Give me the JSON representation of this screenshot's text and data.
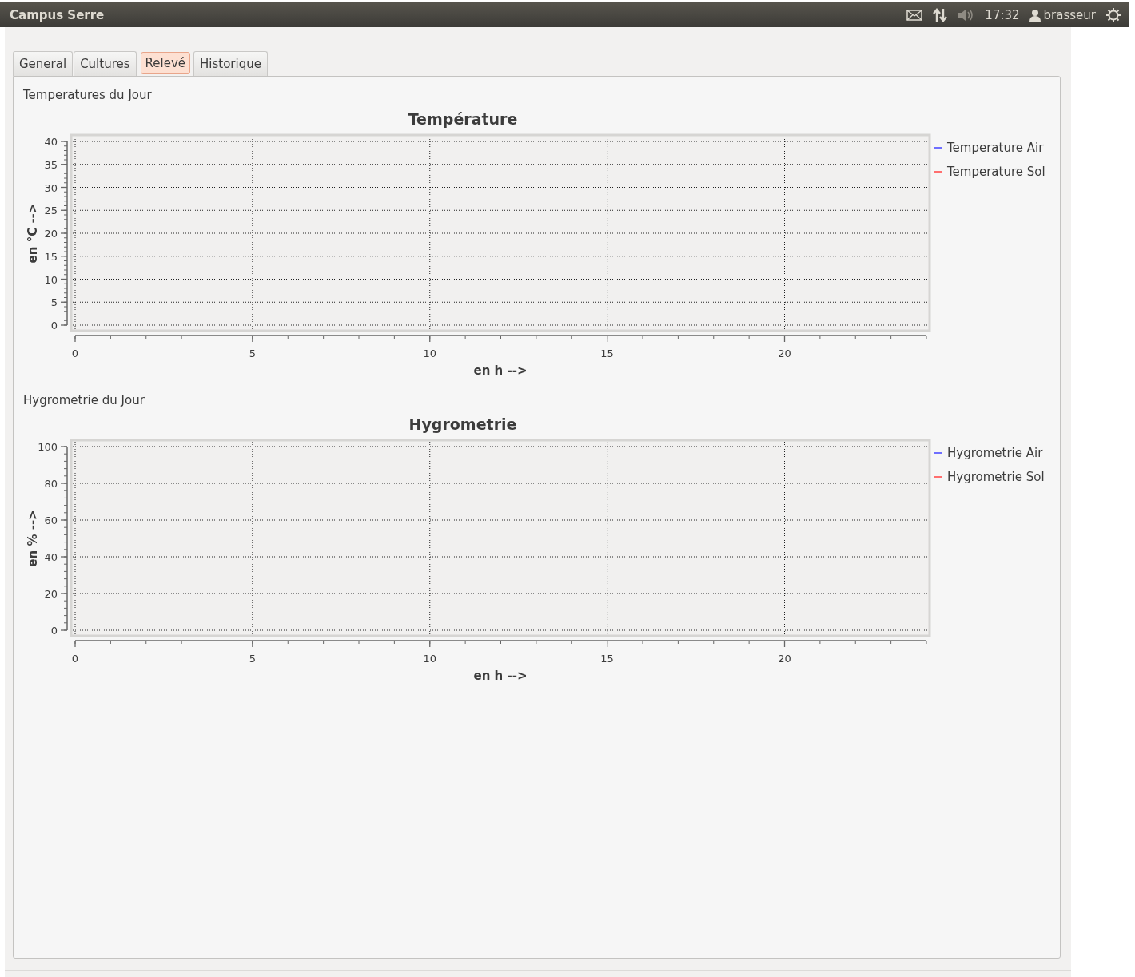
{
  "panel": {
    "title": "Campus Serre",
    "clock": "17:32",
    "user": "brasseur"
  },
  "tabs": [
    {
      "label": "General",
      "selected": false
    },
    {
      "label": "Cultures",
      "selected": false
    },
    {
      "label": "Relevé",
      "selected": true
    },
    {
      "label": "Historique",
      "selected": false
    }
  ],
  "sections": [
    {
      "heading": "Temperatures du Jour",
      "chart_data": {
        "type": "line",
        "title": "Température",
        "xlabel": "en h -->",
        "ylabel": "en °C -->",
        "grid": true,
        "categories": [
          "0",
          "5",
          "10",
          "15",
          "20"
        ],
        "ylim": [
          0,
          40
        ],
        "yticks": [
          0,
          5,
          10,
          15,
          20,
          25,
          30,
          35,
          40
        ],
        "series": [
          {
            "name": "Temperature Air",
            "color": "#6f6fff",
            "values": [
              null,
              null,
              null,
              null,
              null
            ]
          },
          {
            "name": "Temperature Sol",
            "color": "#ff6f6f",
            "values": [
              null,
              null,
              null,
              null,
              null
            ]
          }
        ]
      }
    },
    {
      "heading": "Hygrometrie du Jour",
      "chart_data": {
        "type": "line",
        "title": "Hygrometrie",
        "xlabel": "en h -->",
        "ylabel": "en % -->",
        "grid": true,
        "categories": [
          "0",
          "5",
          "10",
          "15",
          "20"
        ],
        "ylim": [
          0,
          100
        ],
        "yticks": [
          0,
          20,
          40,
          60,
          80,
          100
        ],
        "series": [
          {
            "name": "Hygrometrie Air",
            "color": "#6f6fff",
            "values": [
              null,
              null,
              null,
              null,
              null
            ]
          },
          {
            "name": "Hygrometrie Sol",
            "color": "#ff6f6f",
            "values": [
              null,
              null,
              null,
              null,
              null
            ]
          }
        ]
      }
    }
  ]
}
